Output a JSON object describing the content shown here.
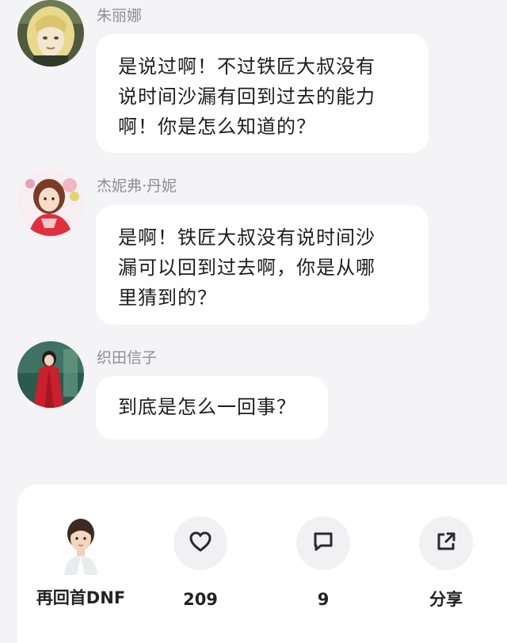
{
  "messages": [
    {
      "sender": "朱丽娜",
      "lines": [
        "是说过啊！不过铁匠大叔没有",
        "说时间沙漏有回到过去的能力",
        "啊！你是怎么知道的？"
      ]
    },
    {
      "sender": "杰妮弗·丹妮",
      "lines": [
        "是啊！铁匠大叔没有说时间沙",
        "漏可以回到过去啊，你是从哪",
        "里猜到的？"
      ]
    },
    {
      "sender": "织田信子",
      "lines": [
        "到底是怎么一回事？"
      ]
    }
  ],
  "footer": {
    "author_name": "再回首DNF",
    "like_count": "209",
    "comment_count": "9",
    "share_label": "分享",
    "icons": {
      "like": "heart-icon",
      "comment": "comment-icon",
      "share": "share-icon"
    }
  }
}
